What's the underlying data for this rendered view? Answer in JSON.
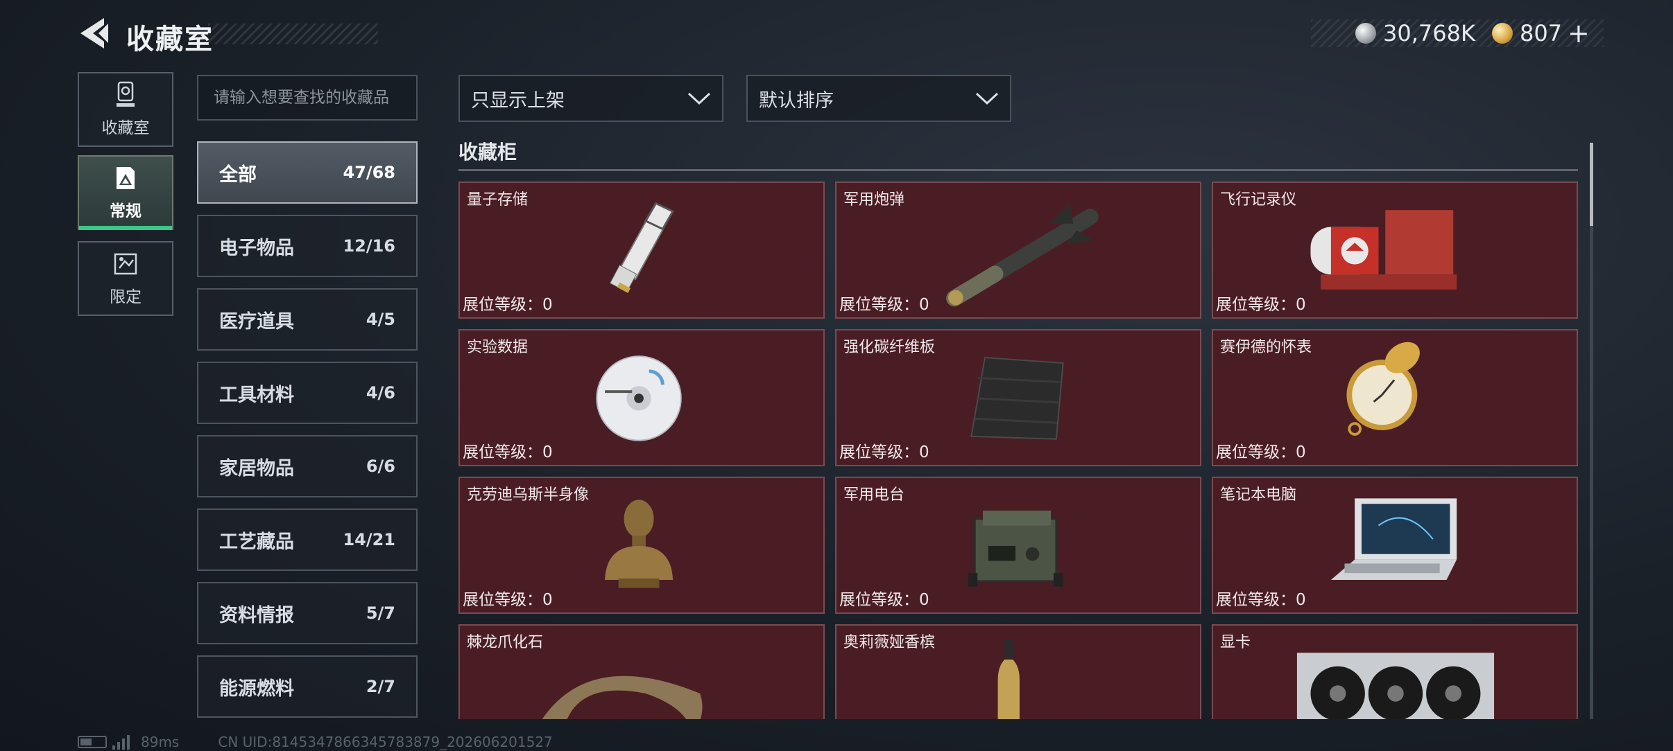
{
  "header": {
    "title": "收藏室",
    "currency_silver": "30,768K",
    "currency_gold": "807",
    "currency_plus": "+"
  },
  "side_nav": [
    {
      "label": "收藏室",
      "icon": "trophy-icon"
    },
    {
      "label": "常规",
      "icon": "regular-collection-icon",
      "active": true
    },
    {
      "label": "限定",
      "icon": "limited-collection-icon"
    }
  ],
  "search": {
    "placeholder": "请输入想要查找的收藏品"
  },
  "categories": [
    {
      "name": "全部",
      "count": "47/68",
      "active": true
    },
    {
      "name": "电子物品",
      "count": "12/16"
    },
    {
      "name": "医疗道具",
      "count": "4/5"
    },
    {
      "name": "工具材料",
      "count": "4/6"
    },
    {
      "name": "家居物品",
      "count": "6/6"
    },
    {
      "name": "工艺藏品",
      "count": "14/21"
    },
    {
      "name": "资料情报",
      "count": "5/7"
    },
    {
      "name": "能源燃料",
      "count": "2/7"
    }
  ],
  "filters": {
    "shelf_filter": "只显示上架",
    "sort": "默认排序"
  },
  "section": {
    "title": "收藏柜"
  },
  "items": [
    {
      "name": "量子存储",
      "level": "展位等级：0",
      "icon": "usb-drive-icon"
    },
    {
      "name": "军用炮弹",
      "level": "展位等级：0",
      "icon": "missile-icon"
    },
    {
      "name": "飞行记录仪",
      "level": "展位等级：0",
      "icon": "flight-recorder-icon"
    },
    {
      "name": "实验数据",
      "level": "展位等级：0",
      "icon": "disc-icon"
    },
    {
      "name": "强化碳纤维板",
      "level": "展位等级：0",
      "icon": "carbon-plate-icon"
    },
    {
      "name": "赛伊德的怀表",
      "level": "展位等级：0",
      "icon": "pocket-watch-icon"
    },
    {
      "name": "克劳迪乌斯半身像",
      "level": "展位等级：0",
      "icon": "bust-icon"
    },
    {
      "name": "军用电台",
      "level": "展位等级：0",
      "icon": "radio-icon"
    },
    {
      "name": "笔记本电脑",
      "level": "展位等级：0",
      "icon": "laptop-icon"
    },
    {
      "name": "棘龙爪化石",
      "level": "",
      "icon": "claw-fossil-icon"
    },
    {
      "name": "奥莉薇娅香槟",
      "level": "",
      "icon": "champagne-icon"
    },
    {
      "name": "显卡",
      "level": "",
      "icon": "graphics-card-icon"
    }
  ],
  "footer": {
    "ping": "89ms",
    "uid": "CN UID:8145347866345783879_202606201527"
  },
  "colors": {
    "card_bg": "#4a1d24",
    "card_border": "#7a4a52",
    "active_tab_accent": "#38c98a"
  }
}
